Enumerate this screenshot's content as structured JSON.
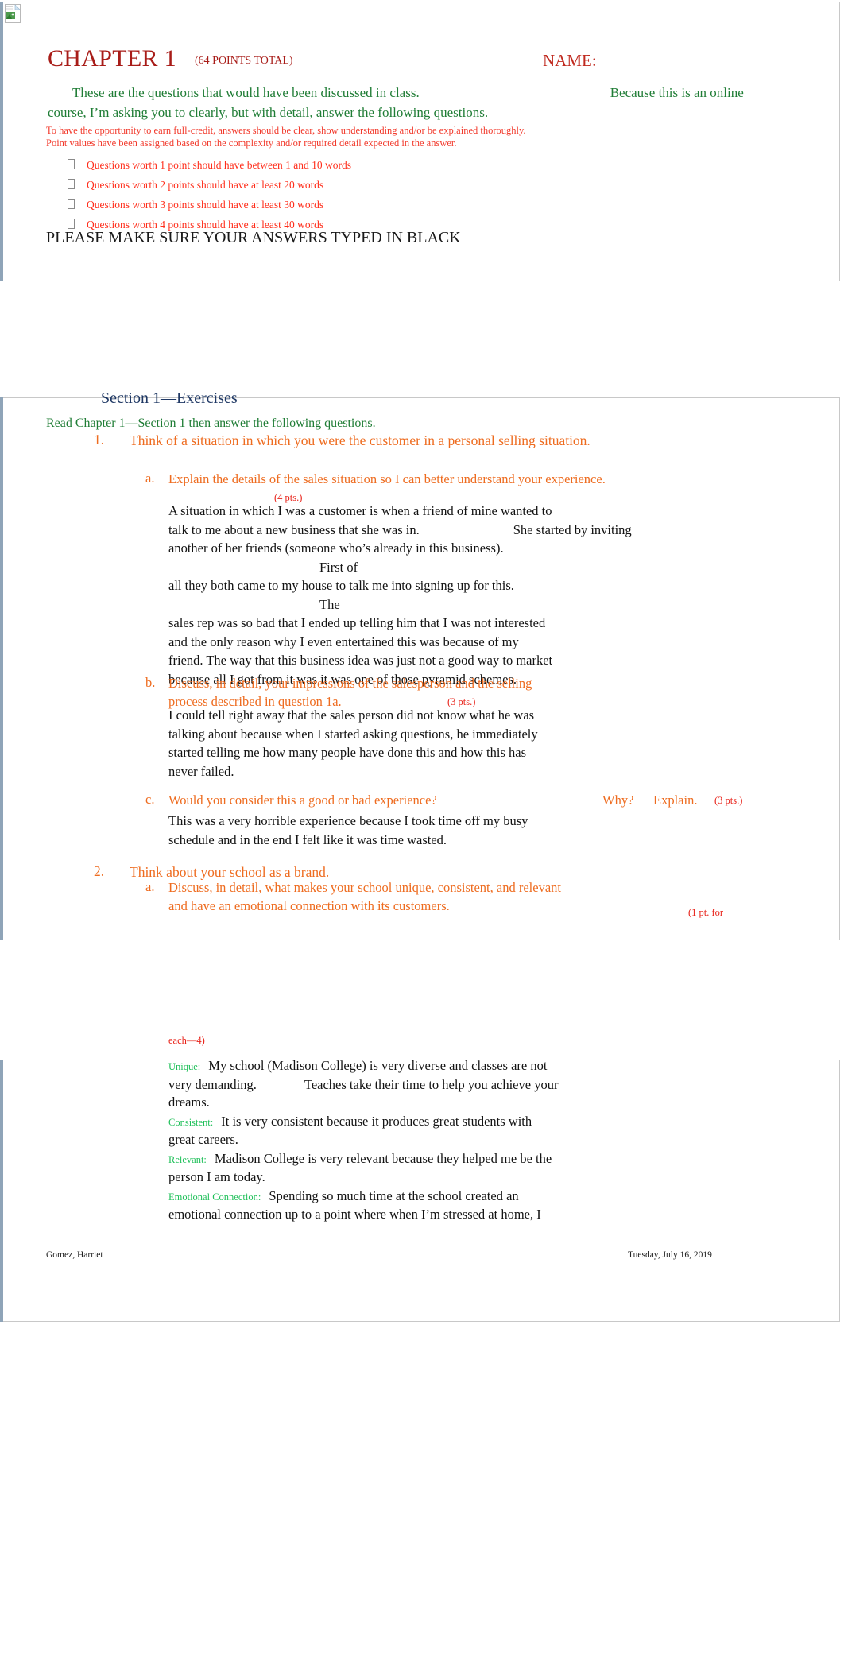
{
  "document": {
    "chapter_title": "CHAPTER 1",
    "chapter_points": "(64 POINTS TOTAL)",
    "name_label": "NAME:",
    "intro_part1": "These are the questions that would have been discussed in class.",
    "intro_part2": "Because this is an online",
    "intro_part3": "course, I’m asking you to clearly, but with detail, answer the following questions.",
    "full_credit_note": "To have the opportunity to earn full-credit, answers should be clear, show understanding and/or be explained thoroughly. Point values have been assigned based on the complexity and/or required detail expected in the answer.",
    "word_count_rules": [
      "Questions worth 1 point should have between 1 and 10 words",
      "Questions worth 2 points should have at least 20 words",
      "Questions worth 3 points should have at least 30 words",
      "Questions worth 4 points should have at least 40 words"
    ],
    "please_black_notice": "PLEASE MAKE SURE YOUR ANSWERS TYPED IN BLACK"
  },
  "section": {
    "heading": "Section 1—Exercises",
    "instruction": "Read Chapter 1—Section 1 then answer the following questions."
  },
  "questions": [
    {
      "number": "1.",
      "prompt": "Think of a situation in which you were the customer in a personal selling situation.",
      "subs": [
        {
          "letter": "a.",
          "prompt": "Explain the details of the sales situation so I can better understand your experience.",
          "points": "(4 pts.)",
          "answer_line1": "A situation in which I was a customer is when a friend of mine wanted to",
          "answer_line2": "talk to me about a new business that she was in.",
          "answer_line2b": "She started by inviting",
          "answer_line3": "another of her friends (someone who’s already in this business).",
          "answer_line3b": "First of",
          "answer_line4": "all they both came to my house to talk me into signing up for this.",
          "answer_line4b": "The",
          "answer_line5": "sales rep was so bad that I ended up telling him that I was not interested",
          "answer_line6": "and the only reason why I even entertained this was because of my",
          "answer_line7": "friend. The way that this business idea was just not a good way to market",
          "answer_line8": "because all I got from it was it was one of those pyramid schemes."
        },
        {
          "letter": "b.",
          "prompt": "Discuss, in detail, your impressions of the salesperson and the selling process described in question 1a.",
          "points": "(3 pts.)",
          "answer_line1": "I could tell right away that the sales person did not know what he was",
          "answer_line2": "talking about because when I started asking questions, he immediately",
          "answer_line3": "started telling me how many people have done this and how this has",
          "answer_line4": "never failed."
        },
        {
          "letter": "c.",
          "prompt": "Would you consider this a good or bad experience?",
          "prompt_why": "Why?",
          "prompt_explain": "Explain.",
          "points": "(3 pts.)",
          "answer_line1": "This was a very horrible experience because I took time off my busy",
          "answer_line2": "schedule and in the end I felt like it was time wasted."
        }
      ]
    },
    {
      "number": "2.",
      "prompt": "Think about your school as a brand.",
      "subs": [
        {
          "letter": "a.",
          "prompt": "Discuss, in detail, what makes your school unique, consistent, and relevant and have an emotional connection with its customers.",
          "points_part1": "(1 pt. for",
          "points_part2": "each—4)",
          "labeled_answers": [
            {
              "label": "Unique:",
              "text_line1": "My school (Madison College) is very diverse and classes are not",
              "text_line2": "very demanding.",
              "text_line2b": "Teaches take their time to help you achieve your",
              "text_line3": "dreams."
            },
            {
              "label": "Consistent:",
              "text_line1": "It is very consistent because it produces great students with",
              "text_line2": "great careers."
            },
            {
              "label": "Relevant:",
              "text_line1": "Madison College is very relevant because they helped me be the",
              "text_line2": "person I am today."
            },
            {
              "label": "Emotional Connection:",
              "text_line1": "Spending so much time at the school created an",
              "text_line2": "emotional connection up to a point where when I’m stressed at home, I"
            }
          ]
        }
      ]
    }
  ],
  "footer": {
    "author": "Gomez, Harriet",
    "date": "Tuesday, July 16, 2019"
  },
  "colors": {
    "heading_red": "#a81c18",
    "name_red": "#c02a1f",
    "intro_green": "#207d36",
    "rule_red": "#ff2d1a",
    "question_orange": "#ee6c20",
    "points_red": "#e8231a",
    "section_navy": "#1f3864",
    "label_green": "#20c05a",
    "answer_black": "#131313"
  }
}
